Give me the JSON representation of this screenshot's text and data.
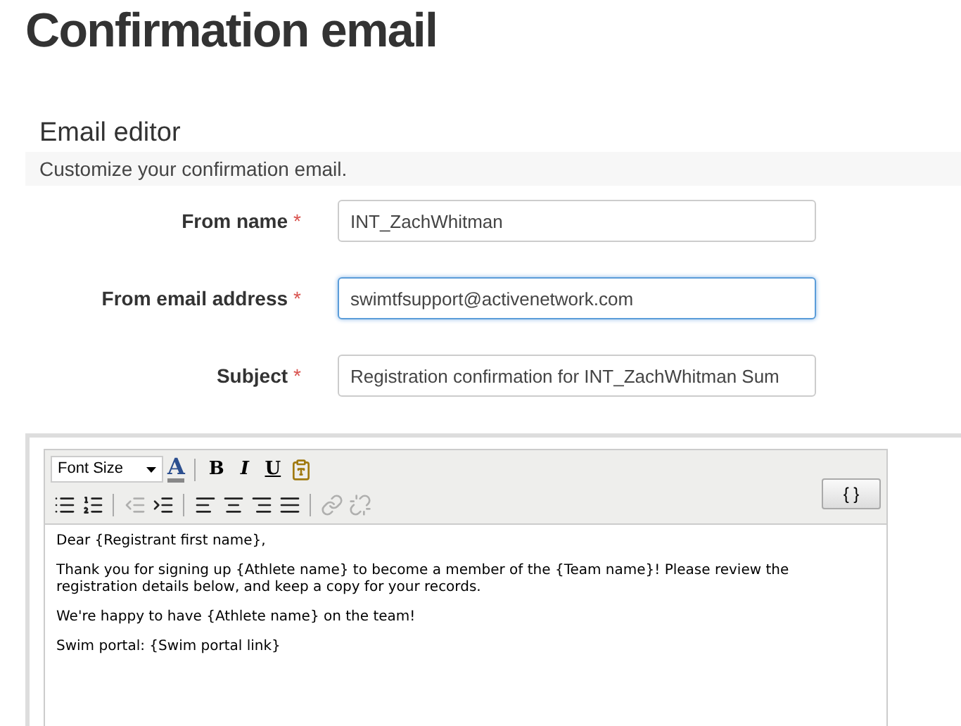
{
  "page_title": "Confirmation email",
  "section": {
    "heading": "Email editor",
    "description": "Customize your confirmation email."
  },
  "fields": [
    {
      "label": "From name",
      "required_mark": "*",
      "value": "INT_ZachWhitman",
      "focused": false
    },
    {
      "label": "From email address",
      "required_mark": "*",
      "value": "swimtfsupport@activenetwork.com",
      "focused": true
    },
    {
      "label": "Subject",
      "required_mark": "*",
      "value": "Registration confirmation for INT_ZachWhitman Sum",
      "focused": false
    }
  ],
  "editor": {
    "toolbar_rows": [
      [
        {
          "kind": "select",
          "label": "Font Size",
          "disabled": false
        },
        {
          "kind": "color",
          "label": "A",
          "disabled": false
        },
        {
          "kind": "sep"
        },
        {
          "kind": "bold",
          "label": "B",
          "disabled": false
        },
        {
          "kind": "italic",
          "label": "I",
          "disabled": false
        },
        {
          "kind": "underline",
          "label": "U",
          "disabled": false
        },
        {
          "kind": "paste",
          "disabled": false
        }
      ],
      [
        {
          "kind": "bullets",
          "disabled": false
        },
        {
          "kind": "numbers",
          "disabled": false
        },
        {
          "kind": "sep"
        },
        {
          "kind": "outdent",
          "disabled": true
        },
        {
          "kind": "indent",
          "disabled": false
        },
        {
          "kind": "sep"
        },
        {
          "kind": "left",
          "disabled": false
        },
        {
          "kind": "center",
          "disabled": false
        },
        {
          "kind": "right",
          "disabled": false
        },
        {
          "kind": "justify",
          "disabled": false
        },
        {
          "kind": "sep"
        },
        {
          "kind": "link",
          "disabled": true
        },
        {
          "kind": "unlink",
          "disabled": true
        }
      ]
    ],
    "placeholder_button": "{ }",
    "paragraphs": [
      "Dear {Registrant first name},",
      "Thank you for signing up {Athlete name} to become a member of the {Team name}! Please review the registration details below, and keep a copy for your records.",
      "We're happy to have {Athlete name} on the team!",
      "Swim portal: {Swim portal link}"
    ]
  }
}
